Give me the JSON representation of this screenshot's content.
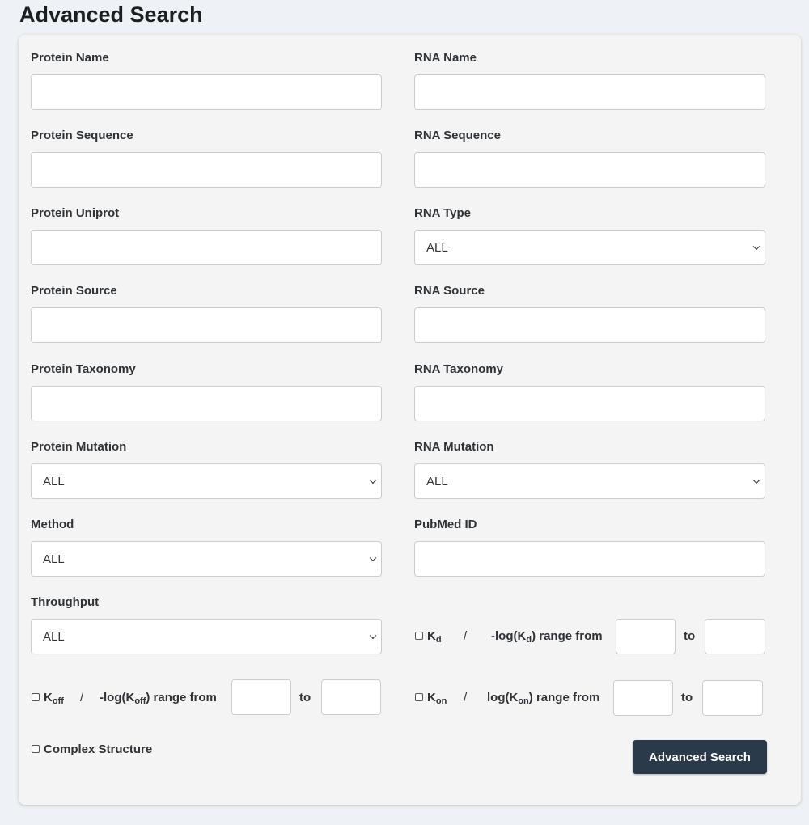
{
  "page": {
    "title": "Advanced Search"
  },
  "fields": {
    "protein_name": {
      "label": "Protein Name",
      "value": ""
    },
    "rna_name": {
      "label": "RNA Name",
      "value": ""
    },
    "protein_sequence": {
      "label": "Protein Sequence",
      "value": ""
    },
    "rna_sequence": {
      "label": "RNA Sequence",
      "value": ""
    },
    "protein_uniprot": {
      "label": "Protein Uniprot",
      "value": ""
    },
    "rna_type": {
      "label": "RNA Type",
      "selected": "ALL"
    },
    "protein_source": {
      "label": "Protein Source",
      "value": ""
    },
    "rna_source": {
      "label": "RNA Source",
      "value": ""
    },
    "protein_taxonomy": {
      "label": "Protein Taxonomy",
      "value": ""
    },
    "rna_taxonomy": {
      "label": "RNA Taxonomy",
      "value": ""
    },
    "protein_mutation": {
      "label": "Protein Mutation",
      "selected": "ALL"
    },
    "rna_mutation": {
      "label": "RNA Mutation",
      "selected": "ALL"
    },
    "method": {
      "label": "Method",
      "selected": "ALL"
    },
    "pubmed_id": {
      "label": "PubMed ID",
      "value": ""
    },
    "throughput": {
      "label": "Throughput",
      "selected": "ALL"
    }
  },
  "ranges": {
    "kd": {
      "checked": false,
      "name": "K",
      "sub": "d",
      "slash": "/",
      "range_prefix": "-log(K",
      "range_sub": "d",
      "range_suffix": ") range from",
      "to": "to",
      "from_value": "",
      "to_value": ""
    },
    "koff": {
      "checked": false,
      "name": "K",
      "sub": "off",
      "slash": "/",
      "range_prefix": "-log(K",
      "range_sub": "off",
      "range_suffix": ") range from",
      "to": "to",
      "from_value": "",
      "to_value": ""
    },
    "kon": {
      "checked": false,
      "name": "K",
      "sub": "on",
      "slash": "/",
      "range_prefix": "log(K",
      "range_sub": "on",
      "range_suffix": ") range from",
      "to": "to",
      "from_value": "",
      "to_value": ""
    }
  },
  "complex_structure": {
    "label": "Complex Structure",
    "checked": false
  },
  "submit": {
    "label": "Advanced Search"
  },
  "colors": {
    "button_bg": "#2b3a4a",
    "card_bg": "#f4f4f4",
    "page_bg": "#eef1f5"
  }
}
